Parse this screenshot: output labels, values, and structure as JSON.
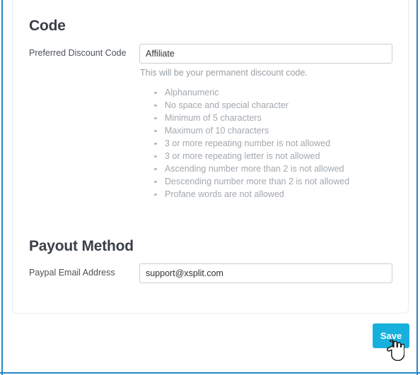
{
  "card": {
    "sections": [
      {
        "heading": "Code",
        "field": {
          "label": "Preferred Discount Code",
          "value": "Affiliate",
          "placeholder": "Preferred Discount Code"
        },
        "helper_text": "This will be your permanent discount code.",
        "rules": [
          "Alphanumeric",
          "No space and special character",
          "Minimum of 5 characters",
          "Maximum of 10 characters",
          "3 or more repeating number is not allowed",
          "3 or more repeating letter is not allowed",
          "Ascending number more than 2 is not allowed",
          "Descending number more than 2 is not allowed",
          "Profane words are not allowed"
        ]
      },
      {
        "heading": "Payout Method",
        "field": {
          "label": "Paypal Email Address",
          "value": "support@xsplit.com",
          "placeholder": "Paypal Email Address"
        }
      }
    ]
  },
  "actions": {
    "save_label": "Save"
  },
  "cursor": {
    "icon": "pointing-hand-cursor"
  },
  "colors": {
    "accent_blue": "#2a87c8",
    "button_cyan": "#17b0dd",
    "heading_text": "#3a4048",
    "label_text": "#4d5259",
    "muted_text": "#a2a8ae",
    "input_border": "#c9ced4",
    "card_border": "#e8eaec"
  }
}
